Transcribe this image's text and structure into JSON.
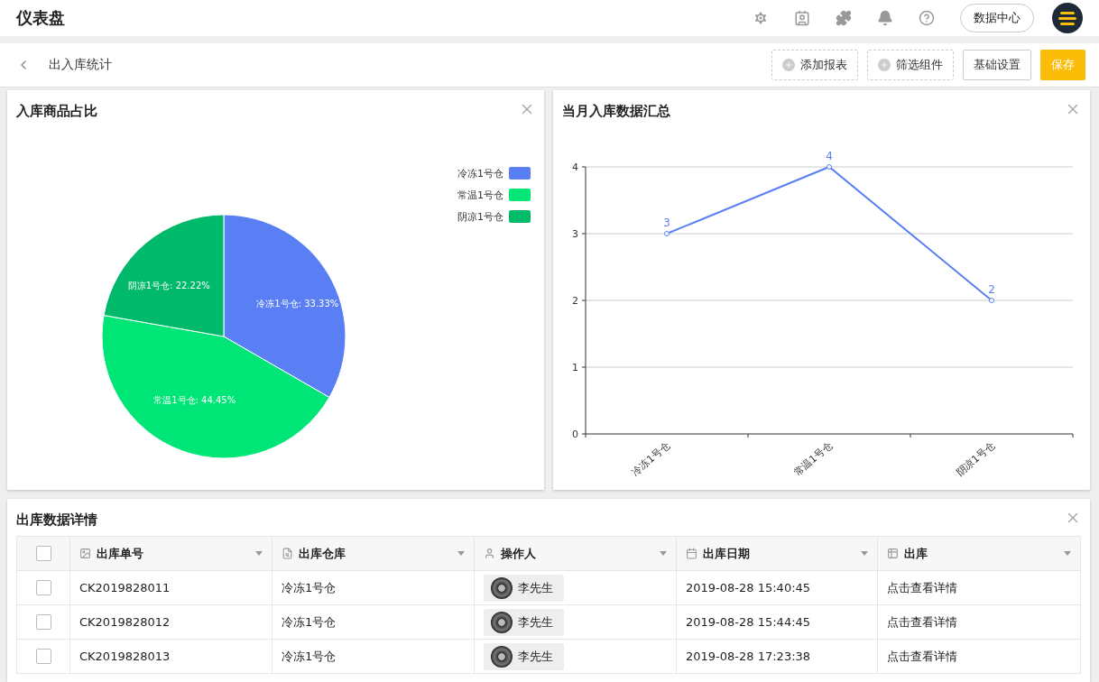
{
  "header": {
    "title": "仪表盘",
    "data_center_button": "数据中心"
  },
  "subheader": {
    "back_label": "出入库统计",
    "buttons": [
      {
        "kind": "dashed",
        "label": "添加报表"
      },
      {
        "kind": "dashed",
        "label": "筛选组件"
      },
      {
        "kind": "plain",
        "label": "基础设置"
      },
      {
        "kind": "primary",
        "label": "保存"
      }
    ]
  },
  "pie_panel": {
    "title": "入库商品占比",
    "chart_data": {
      "type": "pie",
      "categories": [
        "冷冻1号仓",
        "常温1号仓",
        "阴凉1号仓"
      ],
      "values": [
        33.33,
        44.45,
        22.22
      ],
      "colors": [
        "#5a7ff5",
        "#00e676",
        "#00b96b"
      ],
      "value_labels": [
        "冷冻1号仓: 33.33%",
        "常温1号仓: 44.45%",
        "阴凉1号仓: 22.22%"
      ],
      "legend": true
    }
  },
  "line_panel": {
    "title": "当月入库数据汇总",
    "chart_data": {
      "type": "line",
      "categories": [
        "冷冻1号仓",
        "常温1号仓",
        "阴凉1号仓"
      ],
      "series": [
        {
          "color": "#5a7ff5",
          "values": [
            3,
            4,
            2
          ],
          "marker": "circle"
        }
      ],
      "ylim": [
        0,
        4
      ],
      "yticks": [
        0,
        1,
        2,
        3,
        4
      ],
      "data_labels": true,
      "grid": true
    }
  },
  "table_panel": {
    "title": "出库数据详情",
    "all_checked": false,
    "columns": [
      {
        "kind": "image",
        "label": "出库单号"
      },
      {
        "kind": "search",
        "label": "出库仓库"
      },
      {
        "kind": "user",
        "label": "操作人"
      },
      {
        "kind": "date",
        "label": "出库日期"
      },
      {
        "kind": "table",
        "label": "出库"
      }
    ],
    "rows": [
      {
        "checked": false,
        "order": "CK2019828011",
        "warehouse": "冷冻1号仓",
        "operator": "李先生",
        "date": "2019-08-28 15:40:45",
        "action": "点击查看详情"
      },
      {
        "checked": false,
        "order": "CK2019828012",
        "warehouse": "冷冻1号仓",
        "operator": "李先生",
        "date": "2019-08-28 15:44:45",
        "action": "点击查看详情"
      },
      {
        "checked": false,
        "order": "CK2019828013",
        "warehouse": "冷冻1号仓",
        "operator": "李先生",
        "date": "2019-08-28 17:23:38",
        "action": "点击查看详情"
      }
    ]
  }
}
